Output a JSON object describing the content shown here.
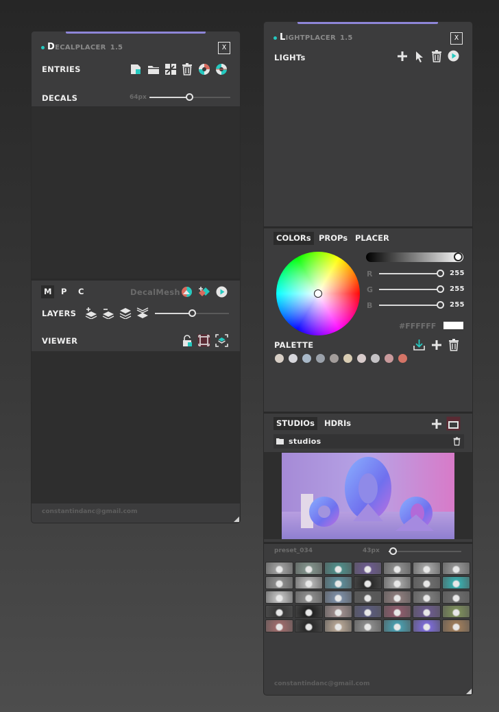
{
  "decalplacer": {
    "title_initial": "D",
    "title_rest": "ECALPLACER",
    "version": "1.5",
    "close_label": "X",
    "entries_label": "ENTRIES",
    "decals_label": "DECALS",
    "decals_size": "64px",
    "decals_slider_fraction": 0.51,
    "mode_tabs": [
      "M",
      "P",
      "C"
    ],
    "mesh_label": "DecalMesh",
    "layers_label": "LAYERS",
    "layers_slider_fraction": 0.55,
    "viewer_label": "VIEWER",
    "footer_email": "constantindanc@gmail.com"
  },
  "lightplacer": {
    "title_initial": "L",
    "title_rest": "IGHTPLACER",
    "version": "1.5",
    "close_label": "X",
    "lights_label": "LIGHTs",
    "tabs": [
      "COLORs",
      "PROPs",
      "PLACER"
    ],
    "rgb": [
      {
        "channel": "R",
        "value": "255"
      },
      {
        "channel": "G",
        "value": "255"
      },
      {
        "channel": "B",
        "value": "255"
      }
    ],
    "hex": "#FFFFFF",
    "palette_label": "PALETTE",
    "palette_colors": [
      "#d8cfc6",
      "#d6d6db",
      "#a8b8c8",
      "#9aa1aa",
      "#a39d9b",
      "#d9cdb3",
      "#d8cbcb",
      "#c4c2c5",
      "#c99a9c",
      "#d47466"
    ],
    "studio_tabs": [
      "STUDIOs",
      "HDRIs"
    ],
    "folder_label": "studios",
    "preset_name": "preset_034",
    "thumb_size": "43px",
    "thumb_slider_fraction": 0.05,
    "footer_email": "constantindanc@gmail.com",
    "accent_color": "#8e86d8",
    "teal_color": "#25c9c0"
  }
}
